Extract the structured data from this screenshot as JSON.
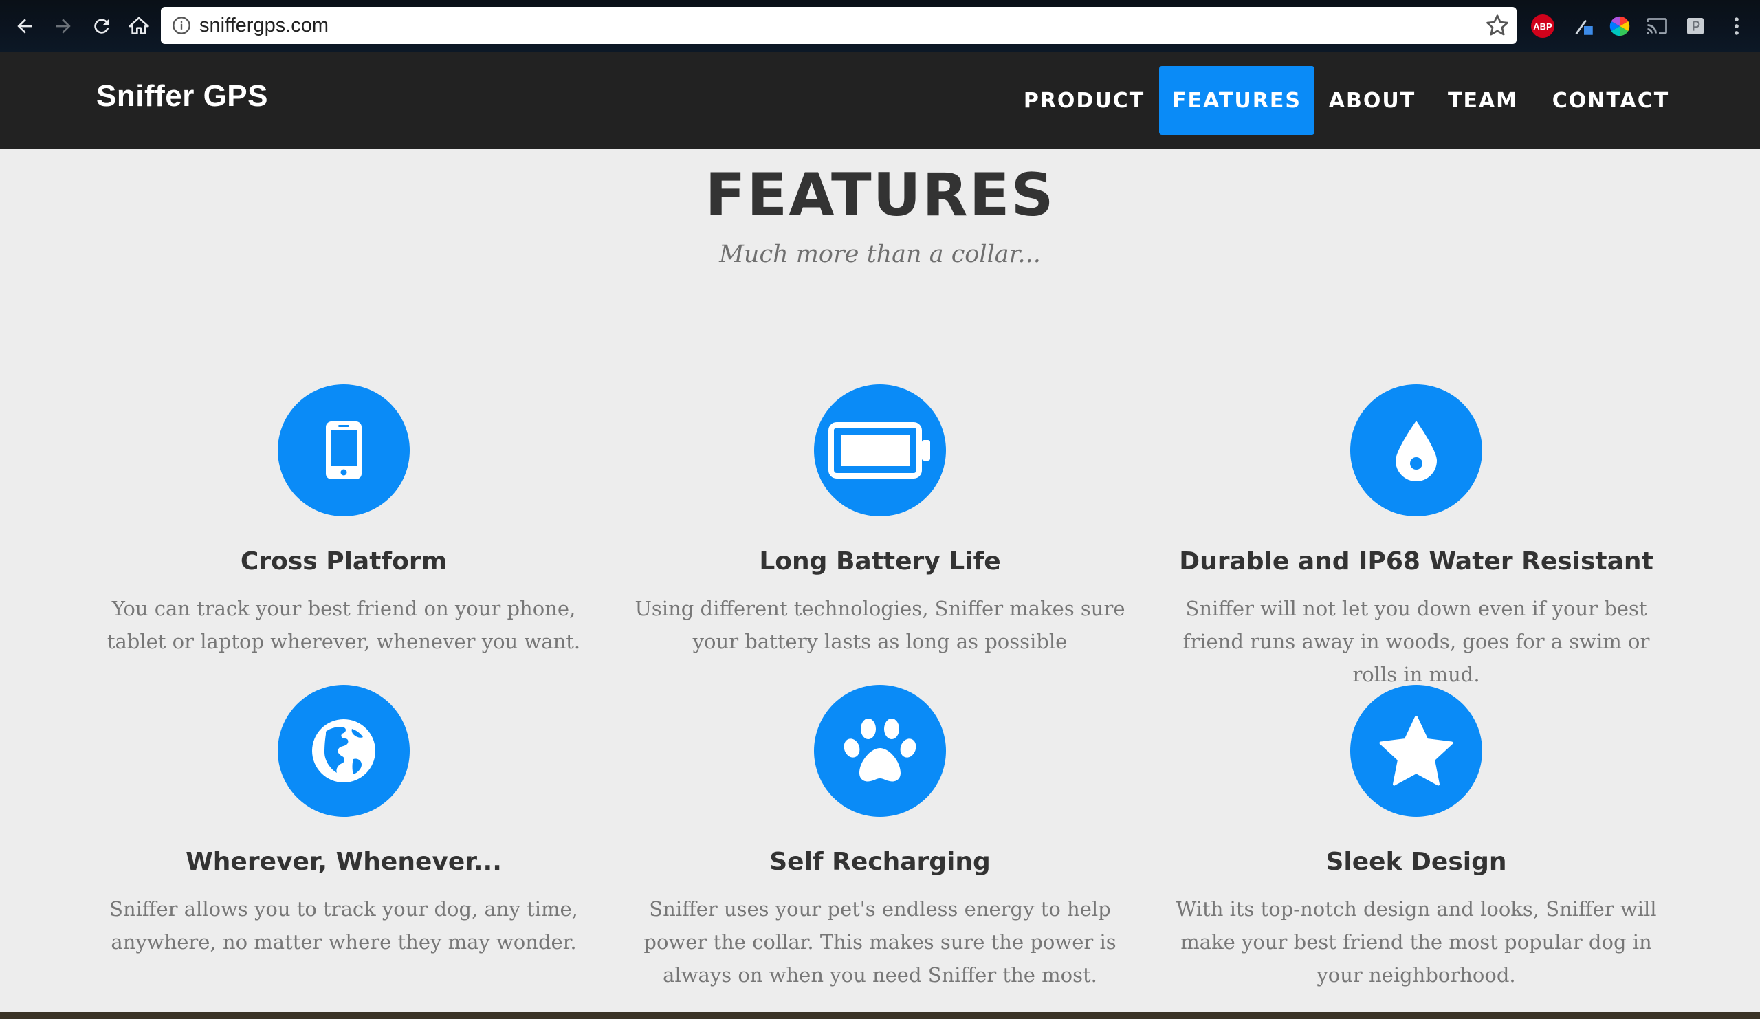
{
  "browser": {
    "url": "sniffergps.com",
    "extensions": {
      "abp_label": "ABP"
    }
  },
  "nav": {
    "brand": "Sniffer GPS",
    "items": [
      {
        "label": "PRODUCT"
      },
      {
        "label": "FEATURES",
        "active": true
      },
      {
        "label": "ABOUT"
      },
      {
        "label": "TEAM"
      },
      {
        "label": "CONTACT"
      }
    ]
  },
  "section": {
    "title": "FEATURES",
    "subtitle": "Much more than a collar..."
  },
  "features": [
    {
      "icon": "phone-icon",
      "title": "Cross Platform",
      "text": "You can track your best friend on your phone, tablet or laptop wherever, whenever you want."
    },
    {
      "icon": "battery-icon",
      "title": "Long Battery Life",
      "text": "Using different technologies, Sniffer makes sure your battery lasts as long as possible"
    },
    {
      "icon": "water-drop-icon",
      "title": "Durable and IP68 Water Resistant",
      "text": "Sniffer will not let you down even if your best friend runs away in woods, goes for a swim or rolls in mud."
    },
    {
      "icon": "globe-icon",
      "title": "Wherever, Whenever...",
      "text": "Sniffer allows you to track your dog, any time, anywhere, no matter where they may wonder."
    },
    {
      "icon": "paw-icon",
      "title": "Self Recharging",
      "text": "Sniffer uses your pet's endless energy to help power the collar. This makes sure the power is always on when you need Sniffer the most."
    },
    {
      "icon": "star-icon",
      "title": "Sleek Design",
      "text": "With its top-notch design and looks, Sniffer will make your best friend the most popular dog in your neighborhood."
    }
  ],
  "colors": {
    "accent": "#0a8bf7",
    "nav_bg": "#222222",
    "content_bg": "#ededed"
  }
}
